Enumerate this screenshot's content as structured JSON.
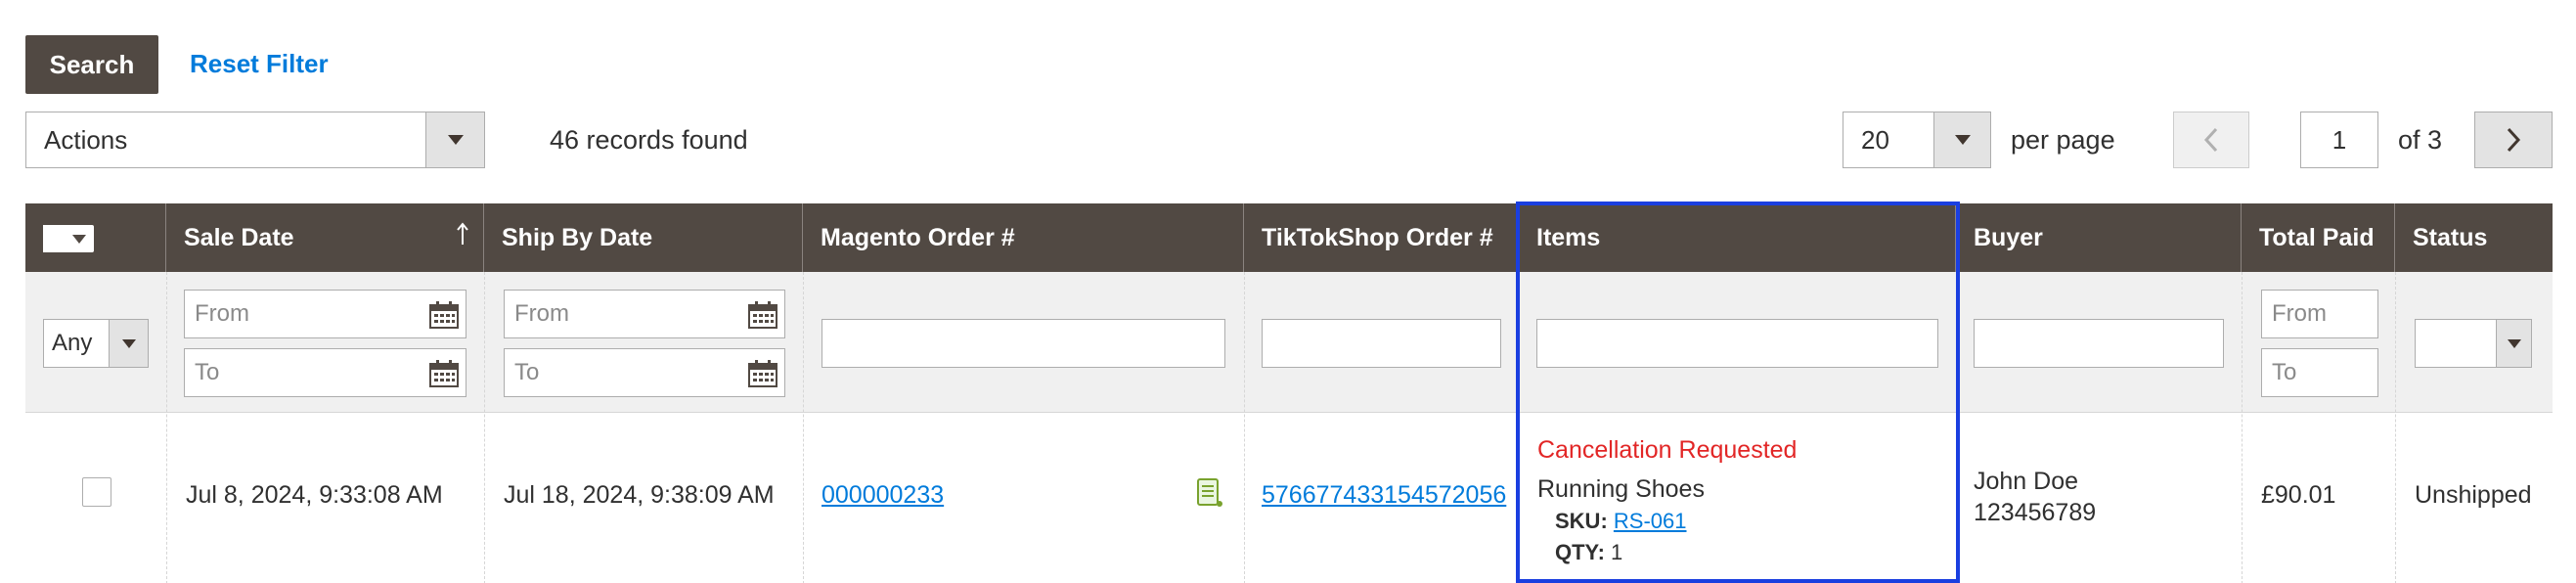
{
  "toolbar": {
    "search_label": "Search",
    "reset_label": "Reset Filter",
    "actions_label": "Actions",
    "records_found": "46 records found",
    "per_page_value": "20",
    "per_page_label": "per page",
    "page_current": "1",
    "page_of": "of 3"
  },
  "columns": {
    "sale_date": "Sale Date",
    "ship_by_date": "Ship By Date",
    "magento_order": "Magento Order #",
    "tiktok_order": "TikTokShop Order #",
    "items": "Items",
    "buyer": "Buyer",
    "total_paid": "Total Paid",
    "status": "Status"
  },
  "filters": {
    "any": "Any",
    "from": "From",
    "to": "To"
  },
  "row": {
    "sale_date": "Jul 8, 2024, 9:33:08 AM",
    "ship_by_date": "Jul 18, 2024, 9:38:09 AM",
    "magento_order": "000000233",
    "tiktok_order": "576677433154572056",
    "item_notice": "Cancellation Requested",
    "item_name": "Running Shoes",
    "sku_label": "SKU:",
    "sku_value": "RS-061",
    "qty_label": "QTY:",
    "qty_value": "1",
    "buyer_name": "John Doe",
    "buyer_id": "123456789",
    "total_paid": "£90.01",
    "status": "Unshipped"
  },
  "colors": {
    "header_bg": "#514943",
    "link": "#007bdb",
    "notice": "#e22626",
    "highlight": "#1a3fe0"
  }
}
